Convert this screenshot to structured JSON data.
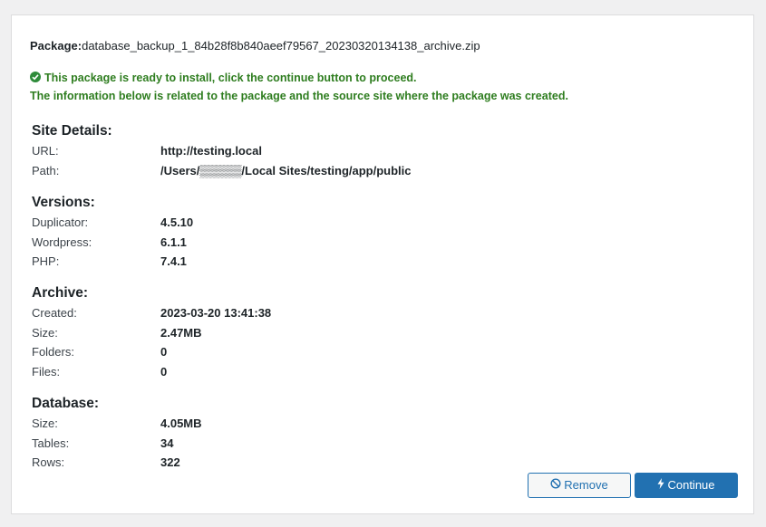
{
  "package": {
    "label": "Package:",
    "filename": "database_backup_1_84b28f8b840aeef79567_20230320134138_archive.zip"
  },
  "notice": {
    "line1": "This package is ready to install, click the continue button to proceed.",
    "line2": "The information below is related to the package and the source site where the package was created."
  },
  "site_details": {
    "title": "Site Details:",
    "rows": [
      {
        "key": "URL:",
        "value": "http://testing.local"
      },
      {
        "key": "Path:",
        "value": "/Users/▒▒▒▒▒/Local Sites/testing/app/public"
      }
    ]
  },
  "versions": {
    "title": "Versions:",
    "rows": [
      {
        "key": "Duplicator:",
        "value": "4.5.10"
      },
      {
        "key": "Wordpress:",
        "value": "6.1.1"
      },
      {
        "key": "PHP:",
        "value": "7.4.1"
      }
    ]
  },
  "archive": {
    "title": "Archive:",
    "rows": [
      {
        "key": "Created:",
        "value": "2023-03-20 13:41:38"
      },
      {
        "key": "Size:",
        "value": "2.47MB"
      },
      {
        "key": "Folders:",
        "value": "0"
      },
      {
        "key": "Files:",
        "value": "0"
      }
    ]
  },
  "database": {
    "title": "Database:",
    "rows": [
      {
        "key": "Size:",
        "value": "4.05MB"
      },
      {
        "key": "Tables:",
        "value": "34"
      },
      {
        "key": "Rows:",
        "value": "322"
      }
    ]
  },
  "buttons": {
    "remove_label": "Remove",
    "continue_label": "Continue",
    "remove_icon": "prohibited-icon",
    "continue_icon": "bolt-icon"
  },
  "colors": {
    "accent": "#2271b1",
    "success": "#2e7d1f"
  }
}
